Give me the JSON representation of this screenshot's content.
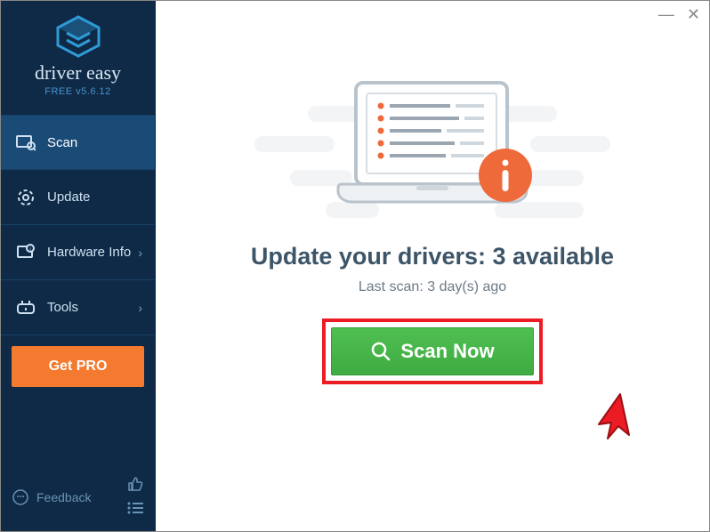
{
  "app": {
    "brand": "driver easy",
    "version": "FREE v5.6.12"
  },
  "sidebar": {
    "items": [
      {
        "label": "Scan"
      },
      {
        "label": "Update"
      },
      {
        "label": "Hardware Info"
      },
      {
        "label": "Tools"
      }
    ],
    "getpro_label": "Get PRO",
    "feedback_label": "Feedback"
  },
  "main": {
    "heading": "Update your drivers: 3 available",
    "last_scan": "Last scan: 3 day(s) ago",
    "scan_label": "Scan Now"
  },
  "colors": {
    "sidebar": "#0e2a47",
    "accent": "#f47a2f",
    "scan_green": "#45b649",
    "highlight_red": "#ec1c24"
  }
}
